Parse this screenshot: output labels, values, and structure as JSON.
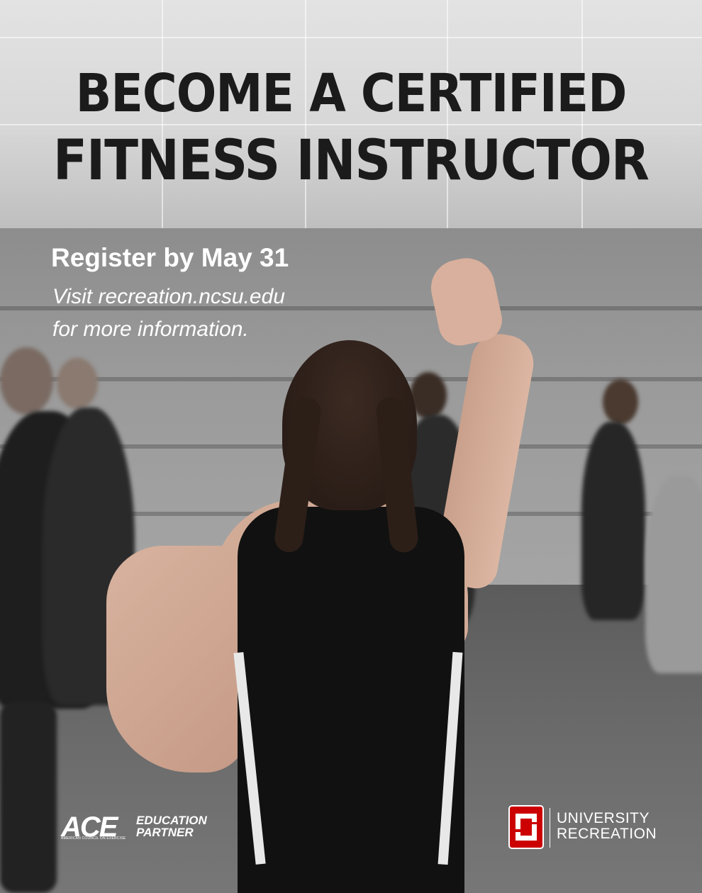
{
  "headline": {
    "line1_prefix": "BECOME A ",
    "line1_bold": "CERTIFIED",
    "line2": "FITNESS INSTRUCTOR"
  },
  "register_text": "Register by May 31",
  "visit_line1": "Visit recreation.ncsu.edu",
  "visit_line2": "for more information.",
  "ace_logo": {
    "mark": "ACE",
    "subtitle": "AMERICAN COUNCIL ON EXERCISE",
    "label_line1": "EDUCATION",
    "label_line2": "PARTNER"
  },
  "nc_logo": {
    "line1": "UNIVERSITY",
    "line2": "RECREATION"
  },
  "colors": {
    "headline": "#1b1b1b",
    "overlay_text": "#ffffff",
    "ncsu_red": "#cc0000"
  }
}
